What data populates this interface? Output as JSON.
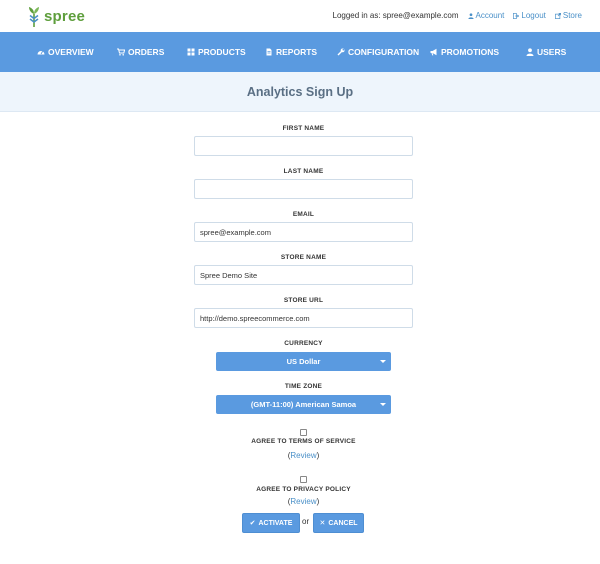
{
  "header": {
    "logo_text": "spree",
    "logged_in_prefix": "Logged in as:",
    "logged_in_email": "spree@example.com",
    "links": [
      {
        "label": "Account",
        "icon": "user-icon"
      },
      {
        "label": "Logout",
        "icon": "logout-icon"
      },
      {
        "label": "Store",
        "icon": "external-link-icon"
      }
    ]
  },
  "nav": {
    "items": [
      {
        "label": "OVERVIEW",
        "icon": "dashboard-icon"
      },
      {
        "label": "ORDERS",
        "icon": "cart-icon"
      },
      {
        "label": "PRODUCTS",
        "icon": "grid-icon"
      },
      {
        "label": "REPORTS",
        "icon": "file-icon"
      },
      {
        "label": "CONFIGURATION",
        "icon": "wrench-icon"
      },
      {
        "label": "PROMOTIONS",
        "icon": "bullhorn-icon"
      },
      {
        "label": "USERS",
        "icon": "user-icon"
      }
    ]
  },
  "page": {
    "title": "Analytics Sign Up"
  },
  "form": {
    "first_name": {
      "label": "FIRST NAME",
      "value": ""
    },
    "last_name": {
      "label": "LAST NAME",
      "value": ""
    },
    "email": {
      "label": "EMAIL",
      "value": "spree@example.com"
    },
    "store_name": {
      "label": "STORE NAME",
      "value": "Spree Demo Site"
    },
    "store_url": {
      "label": "STORE URL",
      "value": "http://demo.spreecommerce.com"
    },
    "currency": {
      "label": "CURRENCY",
      "selected": "US Dollar"
    },
    "time_zone": {
      "label": "TIME ZONE",
      "selected": "(GMT-11:00) American Samoa"
    },
    "terms": {
      "label": "AGREE TO TERMS OF SERVICE",
      "checked": false,
      "open_paren": "(",
      "review": "Review",
      "close_paren": ")"
    },
    "privacy": {
      "label": "AGREE TO PRIVACY POLICY",
      "checked": false,
      "open_paren": "(",
      "review": "Review",
      "close_paren": ")"
    },
    "activate_label": "ACTIVATE",
    "or_text": "or",
    "cancel_label": "CANCEL"
  },
  "colors": {
    "nav_bg": "#5a9ae0",
    "link": "#4a90c8",
    "brand_green": "#5e9e3c",
    "title_band": "#eef5fc"
  }
}
